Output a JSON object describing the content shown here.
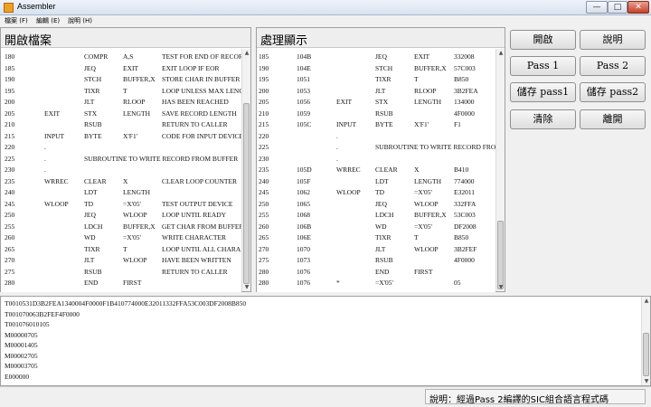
{
  "window": {
    "title": "Assembler",
    "minimize": "—",
    "maximize": "□",
    "close": "✕"
  },
  "menu": [
    {
      "label": "檔案 (F)"
    },
    {
      "label": "編輯 (E)"
    },
    {
      "label": "說明 (H)"
    }
  ],
  "left_panel": {
    "header": "開啟檔案",
    "rows": [
      [
        "180",
        "",
        "COMPR",
        "A,S",
        "TEST FOR END OF RECOR"
      ],
      [
        "185",
        "",
        "JEQ",
        "EXIT",
        "EXIT LOOP IF EOR"
      ],
      [
        "190",
        "",
        "STCH",
        "BUFFER,X",
        "STORE CHAR IN BUFFER"
      ],
      [
        "195",
        "",
        "TIXR",
        "T",
        "LOOP UNLESS MAX LENG"
      ],
      [
        "200",
        "",
        "JLT",
        "RLOOP",
        "HAS BEEN REACHED"
      ],
      [
        "205",
        "EXIT",
        "STX",
        "LENGTH",
        "SAVE RECORD LENGTH"
      ],
      [
        "210",
        "",
        "RSUB",
        "",
        "RETURN TO CALLER"
      ],
      [
        "215",
        "INPUT",
        "BYTE",
        "X'F1'",
        "CODE FOR INPUT DEVICE"
      ],
      [
        "220",
        ".",
        "",
        "",
        ""
      ],
      [
        "225",
        ".",
        "SUBROUTINE TO WRITE RECORD FROM BUFFER",
        "",
        ""
      ],
      [
        "230",
        ".",
        "",
        "",
        ""
      ],
      [
        "235",
        "WRREC",
        "CLEAR",
        "X",
        "CLEAR LOOP COUNTER"
      ],
      [
        "240",
        "",
        "LDT",
        "LENGTH",
        ""
      ],
      [
        "245",
        "WLOOP",
        "TD",
        "=X'05'",
        "TEST OUTPUT DEVICE"
      ],
      [
        "250",
        "",
        "JEQ",
        "WLOOP",
        "LOOP UNTIL READY"
      ],
      [
        "255",
        "",
        "LDCH",
        "BUFFER,X",
        "GET CHAR FROM BUFFER"
      ],
      [
        "260",
        "",
        "WD",
        "=X'05'",
        "WRITE CHARACTER"
      ],
      [
        "265",
        "",
        "TIXR",
        "T",
        "LOOP UNTIL ALL CHARA"
      ],
      [
        "270",
        "",
        "JLT",
        "WLOOP",
        "HAVE BEEN WRITTEN"
      ],
      [
        "275",
        "",
        "RSUB",
        "",
        "RETURN TO CALLER"
      ],
      [
        "280",
        "",
        "END",
        "FIRST",
        ""
      ]
    ]
  },
  "right_panel": {
    "header": "處理顯示",
    "rows": [
      [
        "185",
        "104B",
        "",
        "JEQ",
        "EXIT",
        "332008"
      ],
      [
        "190",
        "104E",
        "",
        "STCH",
        "BUFFER,X",
        "57C003"
      ],
      [
        "195",
        "1051",
        "",
        "TIXR",
        "T",
        "B850"
      ],
      [
        "200",
        "1053",
        "",
        "JLT",
        "RLOOP",
        "3B2FEA"
      ],
      [
        "205",
        "1056",
        "EXIT",
        "STX",
        "LENGTH",
        "134000"
      ],
      [
        "210",
        "1059",
        "",
        "RSUB",
        "",
        "4F0000"
      ],
      [
        "215",
        "105C",
        "INPUT",
        "BYTE",
        "X'F1'",
        "F1"
      ],
      [
        "220",
        "",
        ".",
        "",
        "",
        ""
      ],
      [
        "225",
        "",
        ".",
        "SUBROUTINE TO WRITE RECORD FRO",
        "",
        ""
      ],
      [
        "230",
        "",
        ".",
        "",
        "",
        ""
      ],
      [
        "235",
        "105D",
        "WRREC",
        "CLEAR",
        "X",
        "B410"
      ],
      [
        "240",
        "105F",
        "",
        "LDT",
        "LENGTH",
        "774000"
      ],
      [
        "245",
        "1062",
        "WLOOP",
        "TD",
        "=X'05'",
        "E32011"
      ],
      [
        "250",
        "1065",
        "",
        "JEQ",
        "WLOOP",
        "332FFA"
      ],
      [
        "255",
        "1068",
        "",
        "LDCH",
        "BUFFER,X",
        "53C003"
      ],
      [
        "260",
        "106B",
        "",
        "WD",
        "=X'05'",
        "DF2008"
      ],
      [
        "265",
        "106E",
        "",
        "TIXR",
        "T",
        "B850"
      ],
      [
        "270",
        "1070",
        "",
        "JLT",
        "WLOOP",
        "3B2FEF"
      ],
      [
        "275",
        "1073",
        "",
        "RSUB",
        "",
        "4F0000"
      ],
      [
        "280",
        "1076",
        "",
        "END",
        "FIRST",
        ""
      ],
      [
        "280",
        "1076",
        "*",
        "=X'05'",
        "",
        "05"
      ]
    ]
  },
  "buttons": {
    "open": "開啟",
    "help": "說明",
    "pass1": "Pass 1",
    "pass2": "Pass 2",
    "save_pass1": "儲存 pass1",
    "save_pass2": "儲存 pass2",
    "clear": "清除",
    "exit": "離開"
  },
  "output_lines": [
    "T0010531D3B2FEA1340004F0000F1B410774000E32011332FFA53C003DF2008B850",
    "T001070063B2FEF4F0000",
    "T001076010105",
    "M00000705",
    "M00001405",
    "M00002705",
    "M00003705",
    "E000000"
  ],
  "status": "說明：經過Pass 2編譯的SIC組合語言程式碼"
}
